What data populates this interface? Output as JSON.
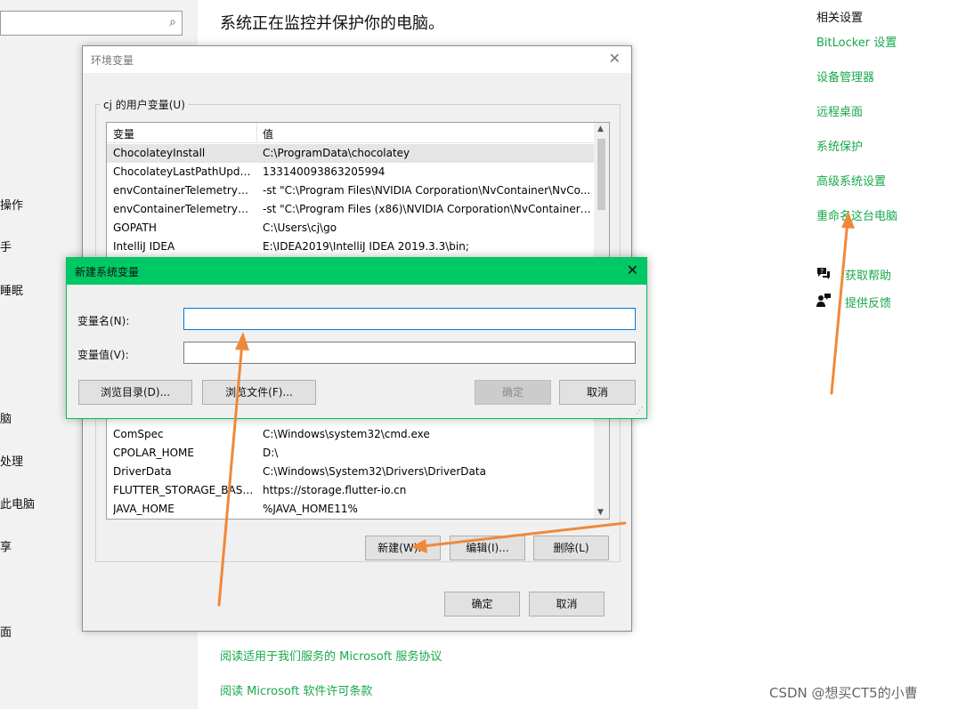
{
  "sidebar": {
    "search_icon": "search-icon",
    "items": [
      "操作",
      "手",
      "睡眠",
      "脑",
      "处理",
      "此电脑",
      "享",
      "面"
    ]
  },
  "main": {
    "title": "系统正在监控并保护你的电脑。",
    "footer_links": [
      "阅读适用于我们服务的 Microsoft 服务协议",
      "阅读 Microsoft 软件许可条款"
    ]
  },
  "related": {
    "heading": "相关设置",
    "links": [
      "BitLocker 设置",
      "设备管理器",
      "远程桌面",
      "系统保护",
      "高级系统设置",
      "重命名这台电脑"
    ],
    "help": "获取帮助",
    "feedback": "提供反馈"
  },
  "env_window": {
    "title": "环境变量",
    "group_label": "cj 的用户变量(U)",
    "col_name": "变量",
    "col_value": "值",
    "rows_top": [
      {
        "name": "ChocolateyInstall",
        "value": "C:\\ProgramData\\chocolatey"
      },
      {
        "name": "ChocolateyLastPathUpdate",
        "value": "133140093863205994"
      },
      {
        "name": "envContainerTelemetryAp...",
        "value": "-st \"C:\\Program Files\\NVIDIA Corporation\\NvContainer\\NvCo..."
      },
      {
        "name": "envContainerTelemetryAp...",
        "value": "-st \"C:\\Program Files (x86)\\NVIDIA Corporation\\NvContainer\\..."
      },
      {
        "name": "GOPATH",
        "value": "C:\\Users\\cj\\go"
      },
      {
        "name": "IntelliJ IDEA",
        "value": "E:\\IDEA2019\\IntelliJ IDEA 2019.3.3\\bin;"
      }
    ],
    "rows_bottom": [
      {
        "name": "ComSpec",
        "value": "C:\\Windows\\system32\\cmd.exe"
      },
      {
        "name": "CPOLAR_HOME",
        "value": "D:\\"
      },
      {
        "name": "DriverData",
        "value": "C:\\Windows\\System32\\Drivers\\DriverData"
      },
      {
        "name": "FLUTTER_STORAGE_BASE_...",
        "value": "https://storage.flutter-io.cn"
      },
      {
        "name": "JAVA_HOME",
        "value": "%JAVA_HOME11%"
      }
    ],
    "btn_new": "新建(W)...",
    "btn_edit": "编辑(I)...",
    "btn_delete": "删除(L)",
    "btn_ok": "确定",
    "btn_cancel": "取消"
  },
  "new_dialog": {
    "title": "新建系统变量",
    "name_label": "变量名(N):",
    "value_label": "变量值(V):",
    "name_value": "",
    "value_value": "",
    "btn_browse_dir": "浏览目录(D)...",
    "btn_browse_file": "浏览文件(F)...",
    "btn_ok": "确定",
    "btn_cancel": "取消"
  },
  "watermark": "CSDN @想买CT5的小曹",
  "colors": {
    "accent_green": "#00c865",
    "link_green": "#18a84b",
    "arrow_orange": "#f0883a"
  }
}
